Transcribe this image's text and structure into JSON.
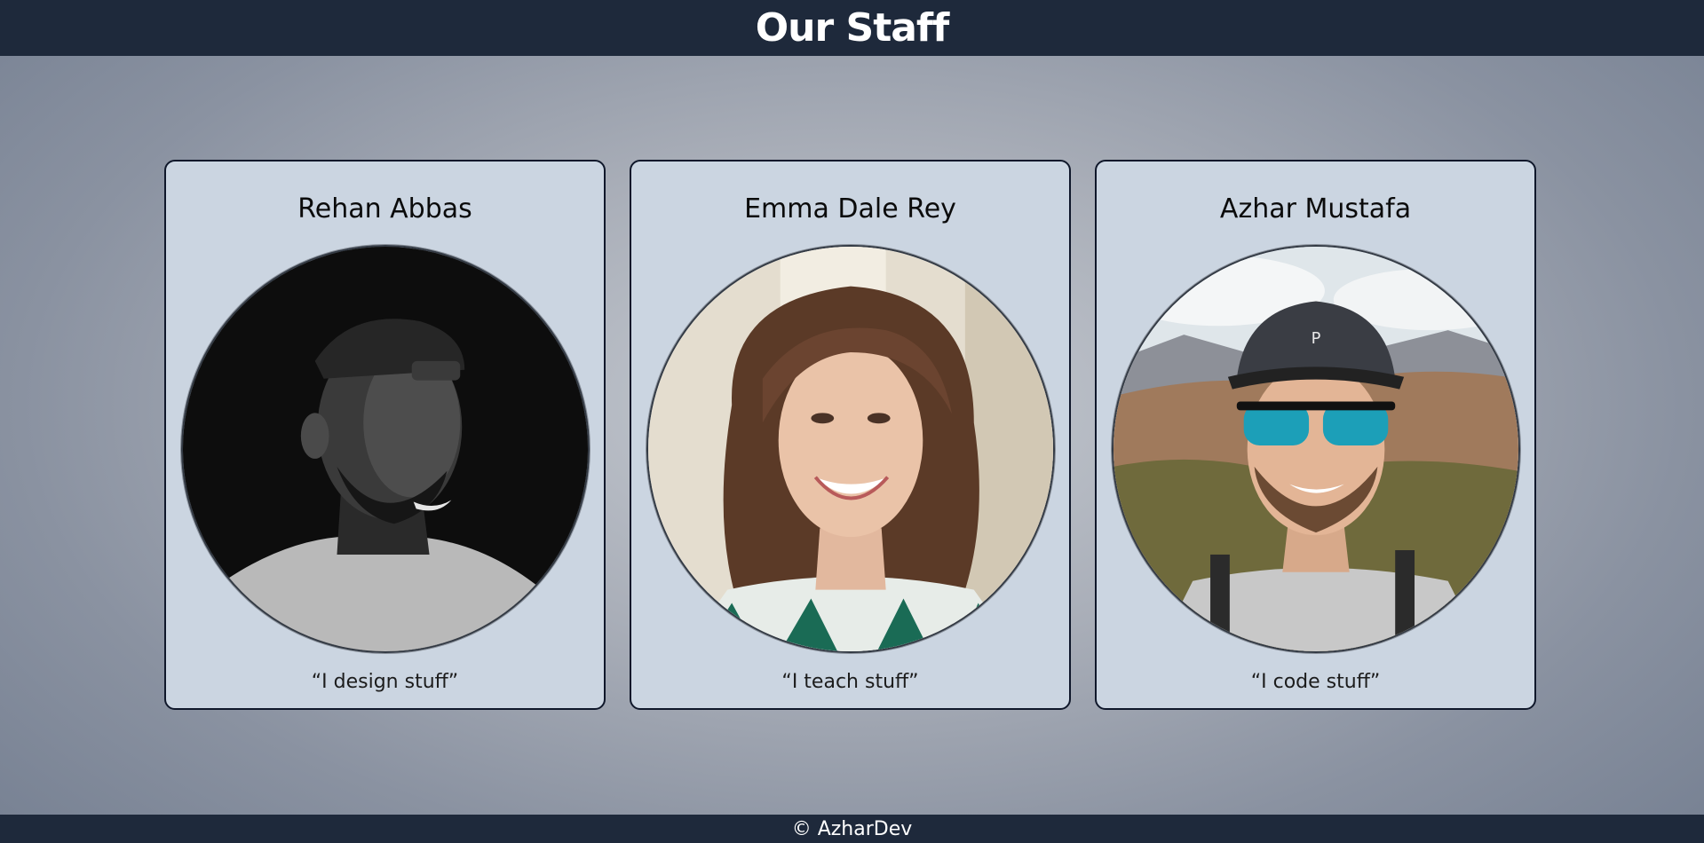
{
  "header": {
    "title": "Our Staff"
  },
  "staff": [
    {
      "name": "Rehan Abbas",
      "quote": "“I design stuff”",
      "photo": "black-and-white portrait of smiling man in backwards cap"
    },
    {
      "name": "Emma Dale Rey",
      "quote": "“I teach stuff”",
      "photo": "color portrait of smiling woman with long wavy hair"
    },
    {
      "name": "Azhar Mustafa",
      "quote": "“I code stuff”",
      "photo": "color portrait of smiling man in cap and mirrored sunglasses outdoors"
    }
  ],
  "footer": {
    "text": "© AzharDev"
  },
  "colors": {
    "header_bg": "#1e293b",
    "card_bg": "#cbd5e1",
    "card_border": "#0f172a"
  }
}
